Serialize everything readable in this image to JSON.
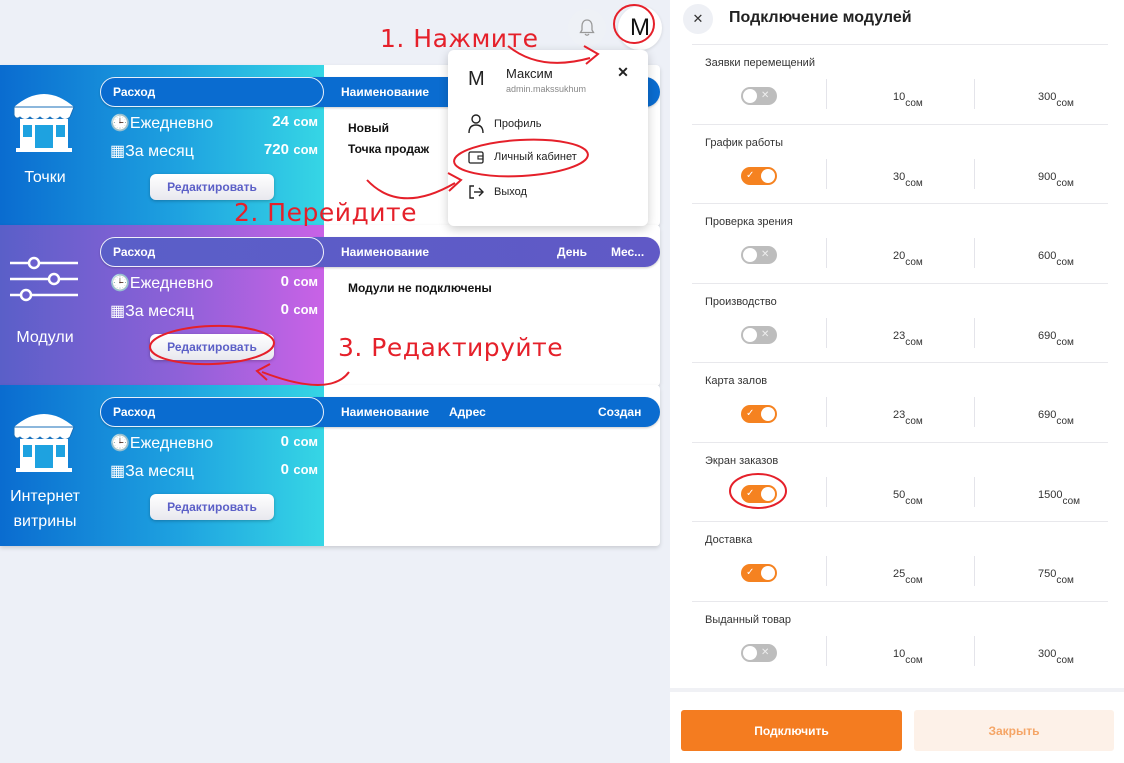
{
  "header": {
    "avatar_letter": "M"
  },
  "dropdown": {
    "avatar_letter": "M",
    "name": "Максим",
    "email": "admin.makssukhum",
    "close": "✕",
    "items": [
      {
        "label": "Профиль",
        "icon": "user-icon"
      },
      {
        "label": "Личный кабинет",
        "icon": "wallet-icon"
      },
      {
        "label": "Выход",
        "icon": "logout-icon"
      }
    ]
  },
  "cards": [
    {
      "label": "Точки",
      "icon": "store-icon",
      "pill": {
        "left": "Расход",
        "cols": [
          "Наименование"
        ]
      },
      "daily_label": "Ежедневно",
      "daily_value": "24",
      "unit": "сом",
      "monthly_label": "За месяц",
      "monthly_value": "720",
      "edit": "Редактировать",
      "rows": [
        "Новый",
        "Точка продаж"
      ]
    },
    {
      "label": "Модули",
      "icon": "sliders-icon",
      "pill": {
        "left": "Расход",
        "cols": [
          "Наименование",
          "День",
          "Мес..."
        ]
      },
      "daily_label": "Ежедневно",
      "daily_value": "0",
      "unit": "сом",
      "monthly_label": "За месяц",
      "monthly_value": "0",
      "edit": "Редактировать",
      "rows": [
        "Модули не подключены"
      ]
    },
    {
      "label_line1": "Интернет",
      "label_line2": "витрины",
      "icon": "store-icon",
      "pill": {
        "left": "Расход",
        "cols": [
          "Наименование",
          "Адрес",
          "Создан"
        ]
      },
      "daily_label": "Ежедневно",
      "daily_value": "0",
      "unit": "сом",
      "monthly_label": "За месяц",
      "monthly_value": "0",
      "edit": "Редактировать"
    }
  ],
  "annotations": {
    "step1": "1. Нажмите",
    "step2": "2. Перейдите",
    "step3": "3. Редактируйте"
  },
  "panel": {
    "title": "Подключение модулей",
    "close": "✕",
    "modules": [
      {
        "name": "Заявки перемещений",
        "enabled": false,
        "day": "10",
        "month": "300",
        "unit": "сом"
      },
      {
        "name": "График работы",
        "enabled": true,
        "day": "30",
        "month": "900",
        "unit": "сом"
      },
      {
        "name": "Проверка зрения",
        "enabled": false,
        "day": "20",
        "month": "600",
        "unit": "сом"
      },
      {
        "name": "Производство",
        "enabled": false,
        "day": "23",
        "month": "690",
        "unit": "сом"
      },
      {
        "name": "Карта залов",
        "enabled": true,
        "day": "23",
        "month": "690",
        "unit": "сом"
      },
      {
        "name": "Экран заказов",
        "enabled": true,
        "day": "50",
        "month": "1500",
        "unit": "сом"
      },
      {
        "name": "Доставка",
        "enabled": true,
        "day": "25",
        "month": "750",
        "unit": "сом"
      },
      {
        "name": "Выданный товар",
        "enabled": false,
        "day": "10",
        "month": "300",
        "unit": "сом"
      }
    ],
    "connect_label": "Подключить",
    "close_label": "Закрыть"
  },
  "colors": {
    "accent": "#f47c20",
    "blue": "#0a6cd0",
    "purple": "#8e61d8",
    "annotation": "#e5202a"
  }
}
